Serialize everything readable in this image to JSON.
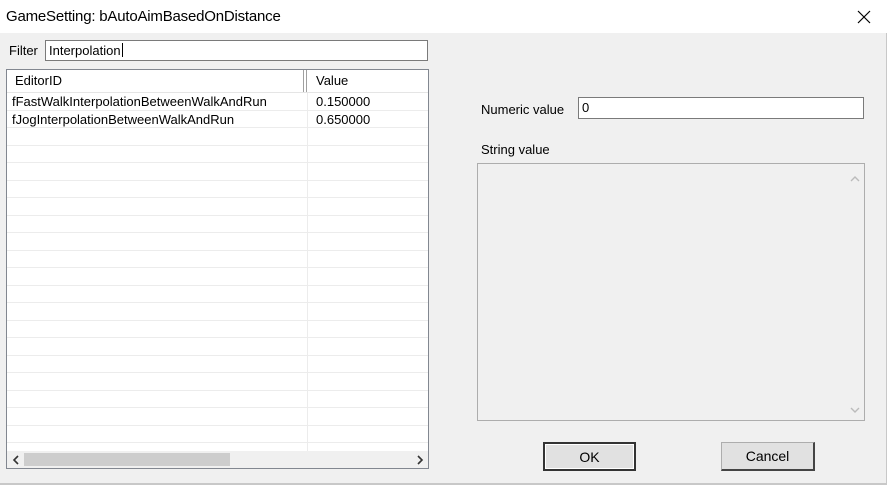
{
  "window": {
    "title": "GameSetting: bAutoAimBasedOnDistance",
    "close_icon": "close-icon"
  },
  "filter": {
    "label": "Filter",
    "value": "Interpolation"
  },
  "list": {
    "columns": [
      "EditorID",
      "Value"
    ],
    "rows": [
      {
        "editor_id": "fFastWalkInterpolationBetweenWalkAndRun",
        "value": "0.150000"
      },
      {
        "editor_id": "fJogInterpolationBetweenWalkAndRun",
        "value": "0.650000"
      }
    ]
  },
  "numeric": {
    "label": "Numeric value",
    "value": "0"
  },
  "string": {
    "label": "String value",
    "value": ""
  },
  "buttons": {
    "ok": "OK",
    "cancel": "Cancel"
  }
}
